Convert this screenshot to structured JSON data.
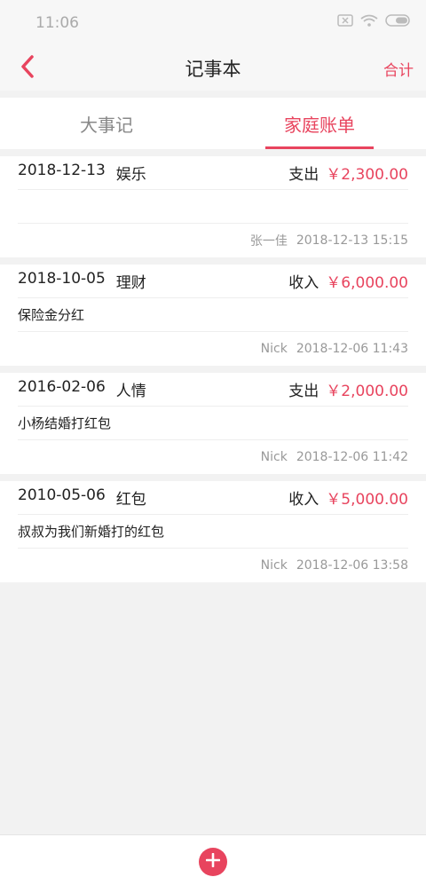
{
  "status_bar": {
    "time": "11:06",
    "icons": [
      "sim-off-icon",
      "wifi-icon",
      "battery-icon"
    ]
  },
  "header": {
    "back_icon": "chevron-left-icon",
    "title": "记事本",
    "action_label": "合计"
  },
  "tabs": [
    {
      "label": "大事记",
      "active": false
    },
    {
      "label": "家庭账单",
      "active": true
    }
  ],
  "records": [
    {
      "date": "2018-12-13",
      "category": "娱乐",
      "type": "支出",
      "amount": "￥2,300.00",
      "note": "",
      "author": "张一佳",
      "timestamp": "2018-12-13 15:15"
    },
    {
      "date": "2018-10-05",
      "category": "理财",
      "type": "收入",
      "amount": "￥6,000.00",
      "note": "保险金分红",
      "author": "Nick",
      "timestamp": "2018-12-06 11:43"
    },
    {
      "date": "2016-02-06",
      "category": "人情",
      "type": "支出",
      "amount": "￥2,000.00",
      "note": "小杨结婚打红包",
      "author": "Nick",
      "timestamp": "2018-12-06 11:42"
    },
    {
      "date": "2010-05-06",
      "category": "红包",
      "type": "收入",
      "amount": "￥5,000.00",
      "note": "叔叔为我们新婚打的红包",
      "author": "Nick",
      "timestamp": "2018-12-06 13:58"
    }
  ],
  "bottom": {
    "add_icon": "plus-icon"
  },
  "colors": {
    "accent": "#e8445e",
    "background": "#f2f2f2",
    "card": "#ffffff"
  }
}
